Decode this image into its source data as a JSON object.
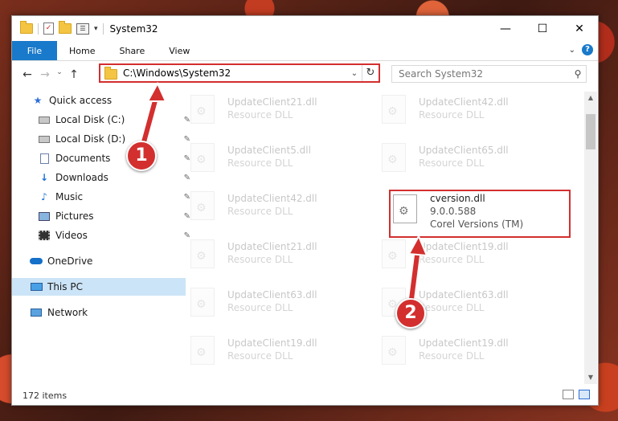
{
  "window": {
    "title": "System32",
    "controls": {
      "minimize": "—",
      "maximize": "☐",
      "close": "✕"
    }
  },
  "ribbon": {
    "tabs": [
      "File",
      "Home",
      "Share",
      "View"
    ],
    "expand": "⌄",
    "help": "?"
  },
  "address_bar": {
    "path": "C:\\Windows\\System32",
    "dropdown": "⌄",
    "refresh": "↻"
  },
  "nav_buttons": {
    "back": "←",
    "forward": "→",
    "recent": "⌄",
    "up": "↑"
  },
  "search": {
    "placeholder": "Search System32",
    "icon": "⚲"
  },
  "sidebar": {
    "items": [
      {
        "label": "Quick access",
        "icon": "star-icon",
        "pinned": false
      },
      {
        "label": "Local Disk (C:)",
        "icon": "drive-icon",
        "pinned": true
      },
      {
        "label": "Local Disk (D:)",
        "icon": "drive-icon",
        "pinned": true
      },
      {
        "label": "Documents",
        "icon": "document-icon",
        "pinned": true
      },
      {
        "label": "Downloads",
        "icon": "download-icon",
        "pinned": true
      },
      {
        "label": "Music",
        "icon": "music-icon",
        "pinned": true
      },
      {
        "label": "Pictures",
        "icon": "picture-icon",
        "pinned": true
      },
      {
        "label": "Videos",
        "icon": "video-icon",
        "pinned": true
      },
      {
        "label": "OneDrive",
        "icon": "cloud-icon",
        "pinned": false
      },
      {
        "label": "This PC",
        "icon": "computer-icon",
        "pinned": false,
        "selected": true
      },
      {
        "label": "Network",
        "icon": "network-icon",
        "pinned": false
      }
    ],
    "pin_glyph": "📌"
  },
  "files": [
    {
      "name": "UpdateClient21.dll",
      "type": "Resource DLL"
    },
    {
      "name": "UpdateClient42.dll",
      "type": "Resource DLL"
    },
    {
      "name": "UpdateClient5.dll",
      "type": "Resource DLL"
    },
    {
      "name": "UpdateClient65.dll",
      "type": "Resource DLL"
    },
    {
      "name": "UpdateClient42.dll",
      "type": "Resource DLL"
    },
    {
      "name": "cversion.dll",
      "version": "9.0.0.588",
      "type": "Corel Versions (TM)",
      "highlighted": true
    },
    {
      "name": "UpdateClient21.dll",
      "type": "Resource DLL"
    },
    {
      "name": "UpdateClient19.dll",
      "type": "Resource DLL"
    },
    {
      "name": "UpdateClient63.dll",
      "type": "Resource DLL"
    },
    {
      "name": "UpdateClient63.dll",
      "type": "Resource DLL"
    },
    {
      "name": "UpdateClient19.dll",
      "type": "Resource DLL"
    },
    {
      "name": "UpdateClient19.dll",
      "type": "Resource DLL"
    }
  ],
  "status": {
    "item_count": "172 items"
  },
  "callouts": [
    {
      "number": "1",
      "color": "#d32f2f"
    },
    {
      "number": "2",
      "color": "#d32f2f"
    }
  ],
  "colors": {
    "accent": "#1979ca",
    "highlight": "#d32f2f",
    "selection": "#cce4f7"
  }
}
